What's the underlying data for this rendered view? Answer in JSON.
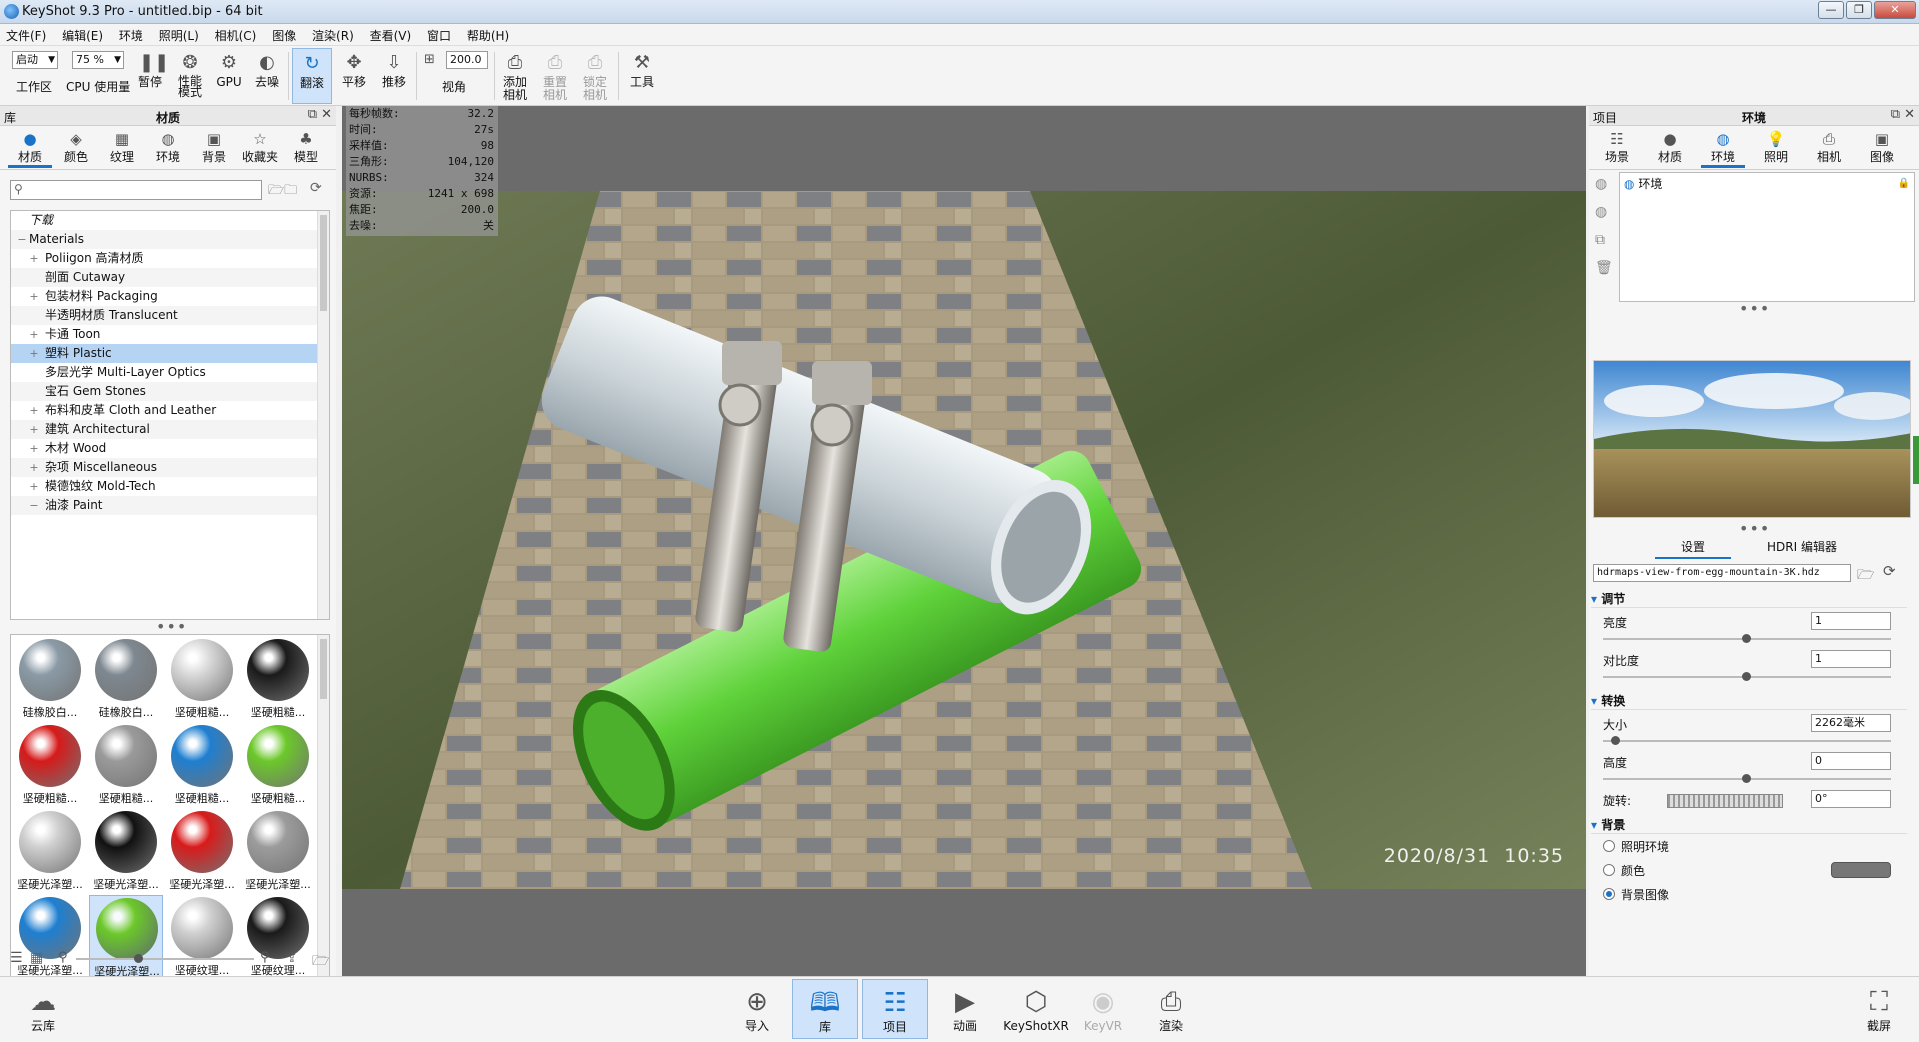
{
  "window": {
    "title": "KeyShot 9.3 Pro - untitled.bip - 64 bit",
    "minimize": "—",
    "restore": "❐",
    "close": "✕"
  },
  "menu": [
    "文件(F)",
    "编辑(E)",
    "环境",
    "照明(L)",
    "相机(C)",
    "图像",
    "渲染(R)",
    "查看(V)",
    "窗口",
    "帮助(H)"
  ],
  "toolbar": {
    "workspace_combo": "启动",
    "workspace_label": "工作区",
    "cpu_combo": "75 %",
    "cpu_label": "CPU 使用量",
    "pause": "暂停",
    "perf_mode": "性能\n模式",
    "gpu": "GPU",
    "denoise": "去噪",
    "tumble": "翻滚",
    "pan": "平移",
    "dolly": "推移",
    "fov_value": "200.0",
    "fov_label": "视角",
    "add_camera": "添加\n相机",
    "reset_camera": "重置\n相机",
    "lock_camera": "锁定\n相机",
    "tools": "工具"
  },
  "library": {
    "header_left": "库",
    "title": "材质",
    "tabs": [
      "材质",
      "颜色",
      "纹理",
      "环境",
      "背景",
      "收藏夹",
      "模型"
    ],
    "search_placeholder": "",
    "tree": [
      {
        "label": "下载",
        "italic": true
      },
      {
        "label": "Materials",
        "exp": "−"
      },
      {
        "label": "Poliigon 高清材质",
        "exp": "+"
      },
      {
        "label": "剖面 Cutaway",
        "exp": ""
      },
      {
        "label": "包装材料 Packaging",
        "exp": "+"
      },
      {
        "label": "半透明材质 Translucent",
        "exp": ""
      },
      {
        "label": "卡通 Toon",
        "exp": "+"
      },
      {
        "label": "塑料 Plastic",
        "exp": "+",
        "selected": true
      },
      {
        "label": "多层光学 Multi-Layer Optics",
        "exp": ""
      },
      {
        "label": "宝石 Gem Stones",
        "exp": ""
      },
      {
        "label": "布料和皮革 Cloth and Leather",
        "exp": "+"
      },
      {
        "label": "建筑 Architectural",
        "exp": "+"
      },
      {
        "label": "木材 Wood",
        "exp": "+"
      },
      {
        "label": "杂项 Miscellaneous",
        "exp": "+"
      },
      {
        "label": "模德蚀纹 Mold-Tech",
        "exp": "+"
      },
      {
        "label": "油漆 Paint",
        "exp": "−"
      }
    ],
    "thumbnails": [
      {
        "label": "硅橡胶白...",
        "color": "#8a9aa6"
      },
      {
        "label": "硅橡胶白...",
        "color": "#7e8890"
      },
      {
        "label": "坚硬粗糙...",
        "color": "#d8d8d8"
      },
      {
        "label": "坚硬粗糙...",
        "color": "#1a1a1a"
      },
      {
        "label": "坚硬粗糙...",
        "color": "#d61a1a"
      },
      {
        "label": "坚硬粗糙...",
        "color": "#9a9a9a"
      },
      {
        "label": "坚硬粗糙...",
        "color": "#1f7fd0"
      },
      {
        "label": "坚硬粗糙...",
        "color": "#6cc82a"
      },
      {
        "label": "坚硬光泽塑...",
        "color": "#d0d0d0"
      },
      {
        "label": "坚硬光泽塑...",
        "color": "#111111"
      },
      {
        "label": "坚硬光泽塑...",
        "color": "#d81b1b"
      },
      {
        "label": "坚硬光泽塑...",
        "color": "#9c9c9c"
      },
      {
        "label": "坚硬光泽塑...",
        "color": "#1f7fd0"
      },
      {
        "label": "坚硬光泽塑...",
        "color": "#6cc82a",
        "selected": true
      },
      {
        "label": "坚硬纹理...",
        "color": "#d0d0d0"
      },
      {
        "label": "坚硬纹理...",
        "color": "#1a1a1a"
      },
      {
        "label": "",
        "color": "#d61a1a"
      },
      {
        "label": "",
        "color": "#9a9a9a"
      },
      {
        "label": "",
        "color": "#1f7fd0"
      },
      {
        "label": "",
        "color": "#6cc82a"
      }
    ]
  },
  "stats": [
    {
      "k": "每秒帧数:",
      "v": "32.2"
    },
    {
      "k": "时间:",
      "v": "27s"
    },
    {
      "k": "采样值:",
      "v": "98"
    },
    {
      "k": "三角形:",
      "v": "104,120"
    },
    {
      "k": "NURBS:",
      "v": "324"
    },
    {
      "k": "资源:",
      "v": "1241 x 698"
    },
    {
      "k": "焦距:",
      "v": "200.0"
    },
    {
      "k": "去噪:",
      "v": "关"
    }
  ],
  "viewport": {
    "timestamp": "2020/8/31  10:35"
  },
  "project": {
    "header_left": "项目",
    "title": "环境",
    "tabs": [
      "场景",
      "材质",
      "环境",
      "照明",
      "相机",
      "图像"
    ],
    "env_item": "环境",
    "subtabs": [
      "设置",
      "HDRI 编辑器"
    ],
    "hdr_file": "hdrmaps-view-from-egg-mountain-3K.hdz",
    "sections": {
      "adjust": "调节",
      "transform": "转换",
      "background": "背景"
    },
    "brightness_label": "亮度",
    "brightness": "1",
    "contrast_label": "对比度",
    "contrast": "1",
    "size_label": "大小",
    "size": "2262毫米",
    "height_label": "高度",
    "height": "0",
    "rotation_label": "旋转:",
    "rotation": "0°",
    "bg_options": [
      "照明环境",
      "颜色",
      "背景图像"
    ]
  },
  "bottombar": {
    "cloud": "云库",
    "import": "导入",
    "library": "库",
    "project": "项目",
    "animation": "动画",
    "keyshotxr": "KeyShotXR",
    "keyvr": "KeyVR",
    "render": "渲染",
    "screenshot": "截屏"
  },
  "colors": {
    "accent": "#1a73c9",
    "selection": "#b5d4f3",
    "viewport_bg": "#6b6b6b"
  }
}
